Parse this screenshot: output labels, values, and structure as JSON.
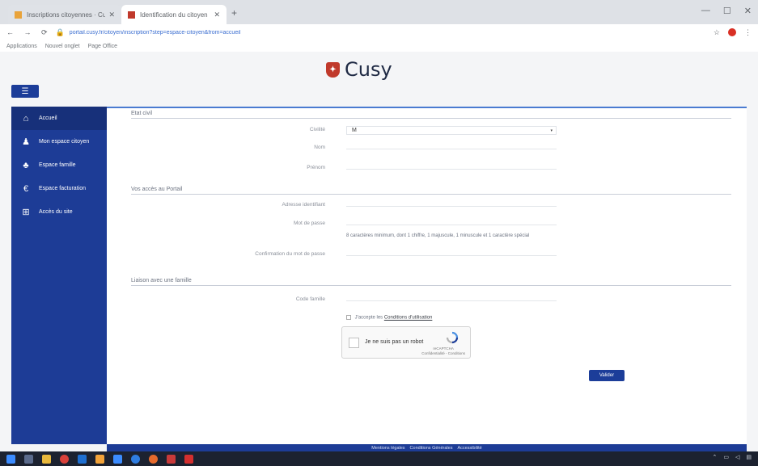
{
  "browser": {
    "tabs": [
      {
        "title": "Inscriptions citoyennes · Cusy",
        "favicon_color": "#e9a33a"
      },
      {
        "title": "Identification du citoyen",
        "favicon_color": "#c0392b"
      }
    ],
    "url": "portail.cusy.fr/citoyen/inscription?step=espace-citoyen&from=accueil",
    "bookmarks": [
      "Applications",
      "Nouvel onglet",
      "Page Office"
    ]
  },
  "site": {
    "logo_text": "Cusy",
    "logo_color": "#c0392b",
    "brand_color": "#1d3c96"
  },
  "sidebar": {
    "items": [
      {
        "label": "Accueil",
        "icon": "home-icon"
      },
      {
        "label": "Mon espace citoyen",
        "icon": "user-icon"
      },
      {
        "label": "Espace famille",
        "icon": "family-icon"
      },
      {
        "label": "Espace facturation",
        "icon": "euro-icon"
      },
      {
        "label": "Accès du site",
        "icon": "sitemap-icon"
      }
    ]
  },
  "form": {
    "sections": {
      "civil": "Etat civil",
      "account": "Vos accès au Portail",
      "family": "Liaison avec une famille"
    },
    "fields": {
      "civility_label": "Civilité",
      "civility_value": "M",
      "name_label": "Nom",
      "firstname_label": "Prénom",
      "email_label": "Adresse identifiant",
      "password_label": "Mot de passe",
      "password_hint": "8 caractères minimum, dont 1 chiffre, 1 majuscule, 1 minuscule et 1 caractère spécial",
      "password_confirm_label": "Confirmation du mot de passe",
      "family_code_label": "Code famille"
    },
    "consent_text": "J'accepte les",
    "consent_link": "Conditions d'utilisation",
    "recaptcha": {
      "label": "Je ne suis pas un robot",
      "brand": "reCAPTCHA",
      "terms": "Confidentialité - Conditions"
    },
    "submit_label": "Valider"
  },
  "footer": {
    "links": [
      "Mentions légales",
      "Conditions Générales",
      "Accessibilité"
    ]
  },
  "window": {
    "minimize": "—",
    "maximize": "☐",
    "close": "✕"
  }
}
